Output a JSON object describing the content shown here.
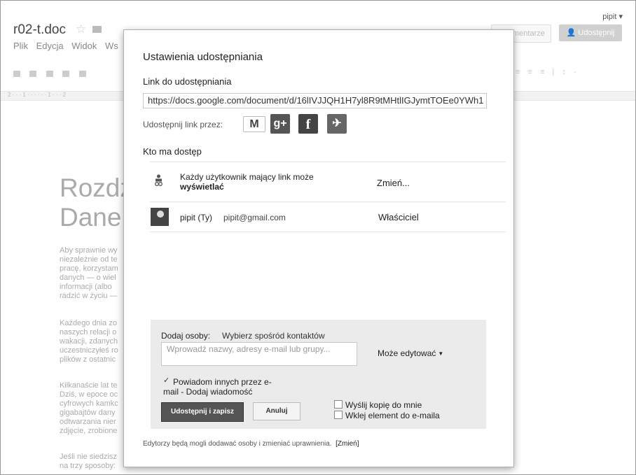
{
  "app": {
    "user": "pipit ▾",
    "doc_title": "r02-t.doc",
    "menu": [
      "Plik",
      "Edycja",
      "Widok",
      "Ws"
    ],
    "comments_label": "mentarze",
    "share_label": "Udostępnij",
    "ruler_numbers": "2 · · · 1 · · · · · · 1 · · · 2",
    "heading_line1": "Rozdz",
    "heading_line2": "Dane",
    "paragraphs": [
      [
        "Aby sprawnie wy",
        "niezależnie od te",
        "pracę, korzystam",
        "danych — o wiel",
        "informacji (albo",
        "radzić w życiu —"
      ],
      [
        "Każdego dnia zo",
        "naszych relacji o",
        "wakacji, zdanych",
        "uczestniczyłeś ro",
        "plików z ostatnic"
      ],
      [
        "Kilkanaście lat te",
        "Dziś, w epoce oc",
        "cyfrowych kamkc",
        "gigabajtów dany",
        "odtwarzania nier",
        "zdjęcie, zrobione"
      ],
      [
        "Jeśli nie siedzisz",
        "na trzy sposoby:"
      ]
    ]
  },
  "dialog": {
    "title": "Ustawienia udostępniania",
    "link_label": "Link do udostępniania",
    "link_value": "https://docs.google.com/document/d/16lIVJJQH1H7yl8R9tMHtlIGJymtTOEe0YWh1",
    "share_via_label": "Udostępnij link przez:",
    "social": [
      "gmail-icon",
      "google-plus-icon",
      "facebook-icon",
      "twitter-icon"
    ],
    "access_label": "Kto ma dostęp",
    "access_rows": [
      {
        "text": "Każdy użytkownik mający link może",
        "bold": "wyświetlać",
        "action": "Zmień..."
      },
      {
        "name": "pipit (Ty)",
        "email": "pipit@gmail.com",
        "role": "Właściciel"
      }
    ],
    "add": {
      "label": "Dodaj osoby:",
      "contacts_link": "Wybierz spośród kontaktów",
      "placeholder": "Wprowadź nazwy, adresy e-mail lub grupy...",
      "permission": "Może edytować",
      "notify_line1": "Powiadom innych przez e-",
      "notify_line2": "mail",
      "add_message": " - Dodaj wiadomość",
      "notify_checked": true,
      "save_button": "Udostępnij i zapisz",
      "cancel_button": "Anuluj",
      "copy_me": "Wyślij kopię do mnie",
      "paste_item": "Wklej element do e-maila"
    },
    "footer": "Edytorzy będą mogli dodawać osoby i zmieniać uprawnienia.",
    "footer_link": "[Zmień]"
  }
}
